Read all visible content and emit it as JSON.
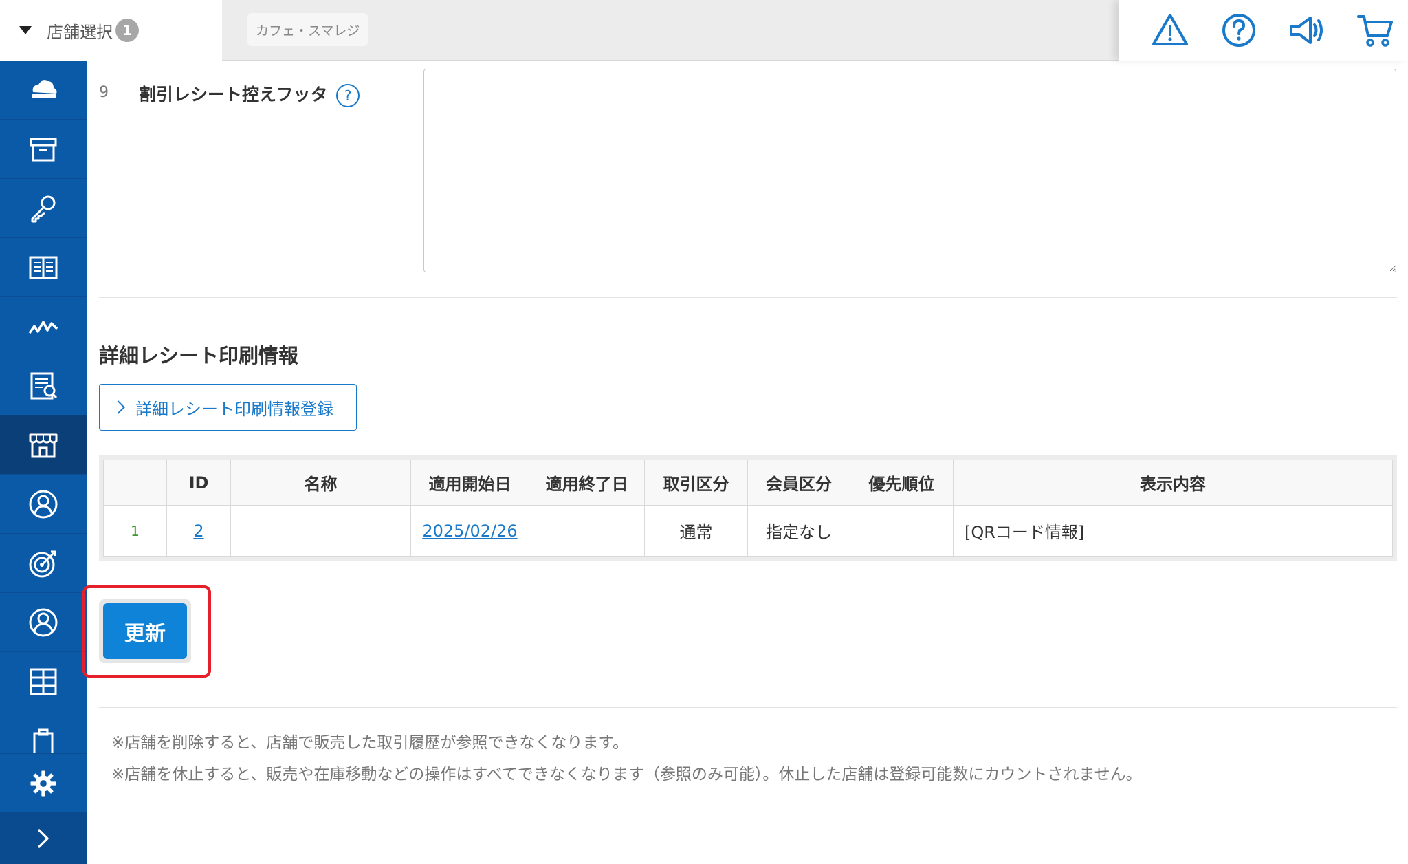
{
  "header": {
    "store_select_label": "店舗選択",
    "store_count": "1",
    "selected_store": "カフェ・スマレジ",
    "icons": [
      "warning-icon",
      "help-icon",
      "megaphone-icon",
      "cart-icon"
    ]
  },
  "sidebar": {
    "items": [
      "cloud-register-icon",
      "archive-icon",
      "key-icon",
      "book-icon",
      "chart-icon",
      "report-icon",
      "store-icon",
      "customer-icon",
      "target-icon",
      "user-icon",
      "grid-icon",
      "clipboard-icon"
    ],
    "active": "store-icon",
    "bottom": [
      "gear-icon",
      "chevron-right-icon"
    ]
  },
  "form": {
    "row_number": "9",
    "footer_label": "割引レシート控えフッタ",
    "help_symbol": "?",
    "footer_value": ""
  },
  "detail_section": {
    "title": "詳細レシート印刷情報",
    "register_button": "詳細レシート印刷情報登録",
    "table": {
      "headers": [
        "",
        "ID",
        "名称",
        "適用開始日",
        "適用終了日",
        "取引区分",
        "会員区分",
        "優先順位",
        "表示内容"
      ],
      "rows": [
        {
          "no": "1",
          "id": "2",
          "name": "",
          "start": "2025/02/26",
          "end": "",
          "transaction": "通常",
          "member": "指定なし",
          "priority": "",
          "content": "[QRコード情報]"
        }
      ]
    }
  },
  "actions": {
    "update_button": "更新"
  },
  "notes": [
    "※店舗を削除すると、店舗で販売した取引履歴が参照できなくなります。",
    "※店舗を休止すると、販売や在庫移動などの操作はすべてできなくなります（参照のみ可能）。休止した店舗は登録可能数にカウントされません。"
  ],
  "colors": {
    "sidebar": "#0a5aa8",
    "accent": "#1a7ac9",
    "update_button": "#0f83d8",
    "highlight": "#e6202a"
  }
}
